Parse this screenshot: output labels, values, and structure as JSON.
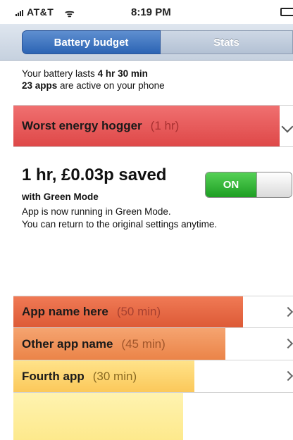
{
  "status_bar": {
    "carrier": "AT&T",
    "wifi_glyph": "ᯤ",
    "time": "8:19 PM"
  },
  "tabs": [
    {
      "label": "Battery budget",
      "active": true
    },
    {
      "label": "Stats",
      "active": false
    }
  ],
  "summary": {
    "line1_prefix": "Your battery lasts ",
    "line1_value": "4 hr 30 min",
    "line2_value": "23 apps",
    "line2_suffix": " are active on your phone"
  },
  "hogger": {
    "title": "Worst energy hogger",
    "time": "(1 hr)"
  },
  "detail": {
    "saved": "1 hr, £0.03p saved",
    "mode": "with Green Mode",
    "toggle_label": "ON",
    "message_line1": "App is now running in Green Mode.",
    "message_line2": "You can return to the original settings anytime."
  },
  "apps": [
    {
      "name": "App name here",
      "time": "(50 min)"
    },
    {
      "name": "Other app name",
      "time": "(45 min)"
    },
    {
      "name": "Fourth app",
      "time": "(30 min)"
    }
  ],
  "colors": {
    "segment_active": "#2b64b4",
    "hogger": "#de4848",
    "app1": "#dd5a36",
    "app2": "#eb8448",
    "app3": "#fbc85a",
    "toggle_on": "#1e9e23"
  }
}
